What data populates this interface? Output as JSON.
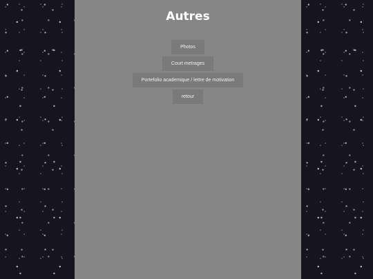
{
  "page": {
    "title": "Autres"
  },
  "menu": {
    "items": [
      {
        "label": "Photos"
      },
      {
        "label": "Court metrages"
      },
      {
        "label": "Portefolio academique / lettre de motivation"
      },
      {
        "label": "retour"
      }
    ]
  },
  "colors": {
    "panel_background": "#868686",
    "button_background": "#7a7a7a",
    "title_text": "#ffffff",
    "button_text": "#efefef",
    "side_background": "#16141f"
  }
}
